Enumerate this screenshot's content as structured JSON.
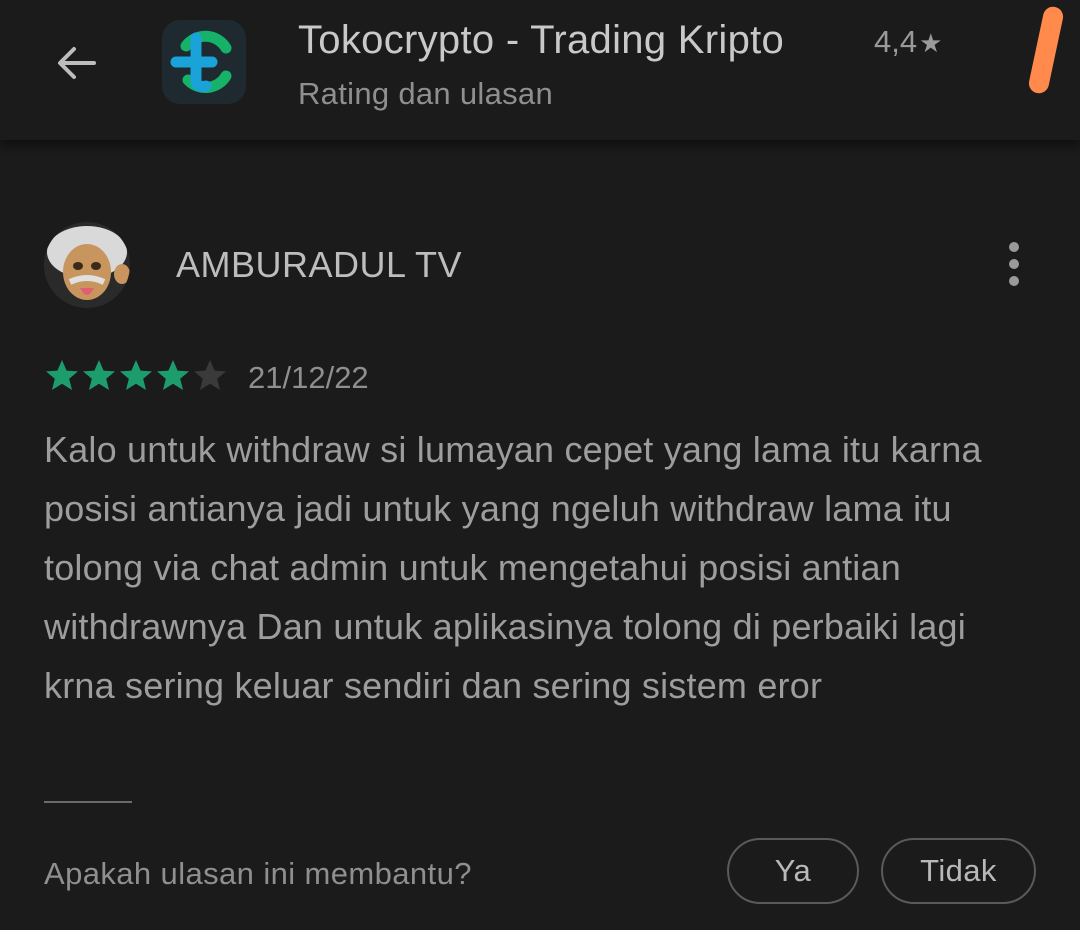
{
  "header": {
    "app_name": "Tokocrypto - Trading Kripto",
    "app_rating": "4,4",
    "subtitle": "Rating dan ulasan",
    "back_icon": "back-arrow-icon",
    "app_icon": "tokocrypto-logo-icon",
    "colors": {
      "brand_blue": "#1aa3d9",
      "brand_green": "#17b26a",
      "scroll_accent": "#ff8a4c"
    }
  },
  "review": {
    "reviewer_name": "AMBURADUL TV",
    "rating": 4,
    "max_rating": 5,
    "date": "21/12/22",
    "text": "Kalo untuk withdraw si lumayan cepet yang lama itu karna posisi antianya jadi untuk yang ngeluh withdraw lama itu tolong via chat admin untuk mengetahui posisi antian withdrawnya Dan untuk aplikasinya tolong di perbaiki lagi krna sering keluar sendiri dan sering sistem eror",
    "star_color": "#1d9c6e",
    "helpful_question": "Apakah ulasan ini membantu?",
    "yes_label": "Ya",
    "no_label": "Tidak"
  }
}
